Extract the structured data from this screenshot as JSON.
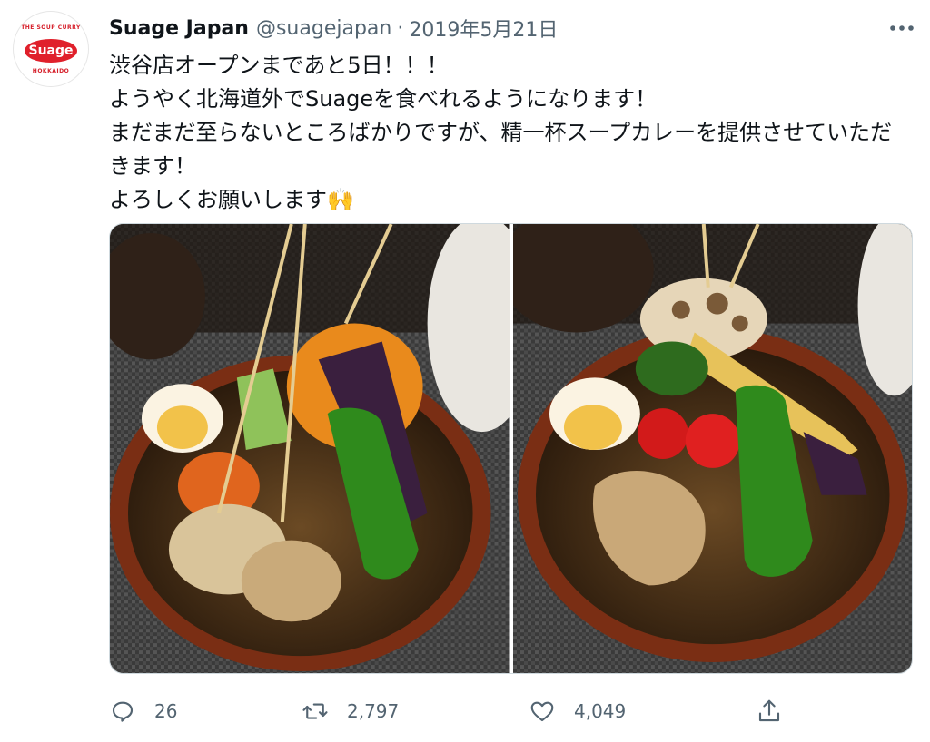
{
  "account": {
    "avatar_top_text": "THE SOUP CURRY",
    "avatar_logo_text": "Suage",
    "avatar_bottom_text": "HOKKAIDO",
    "display_name": "Suage Japan",
    "handle": "@suagejapan",
    "separator": "·",
    "date": "2019年5月21日"
  },
  "tweet": {
    "line1": "渋谷店オープンまであと5日！！！",
    "line2": "ようやく北海道外でSuageを食べれるようになります！",
    "line3": "まだまだ至らないところばかりですが、精一杯スープカレーを提供させていただきます！",
    "line4": "よろしくお願いします🙌"
  },
  "media": [
    {
      "icon": "soup-curry-photo"
    },
    {
      "icon": "soup-curry-photo"
    }
  ],
  "actions": {
    "reply_count": "26",
    "retweet_count": "2,797",
    "like_count": "4,049"
  },
  "colors": {
    "text": "#0f1419",
    "secondary": "#536471",
    "brand_red": "#e0202b"
  }
}
